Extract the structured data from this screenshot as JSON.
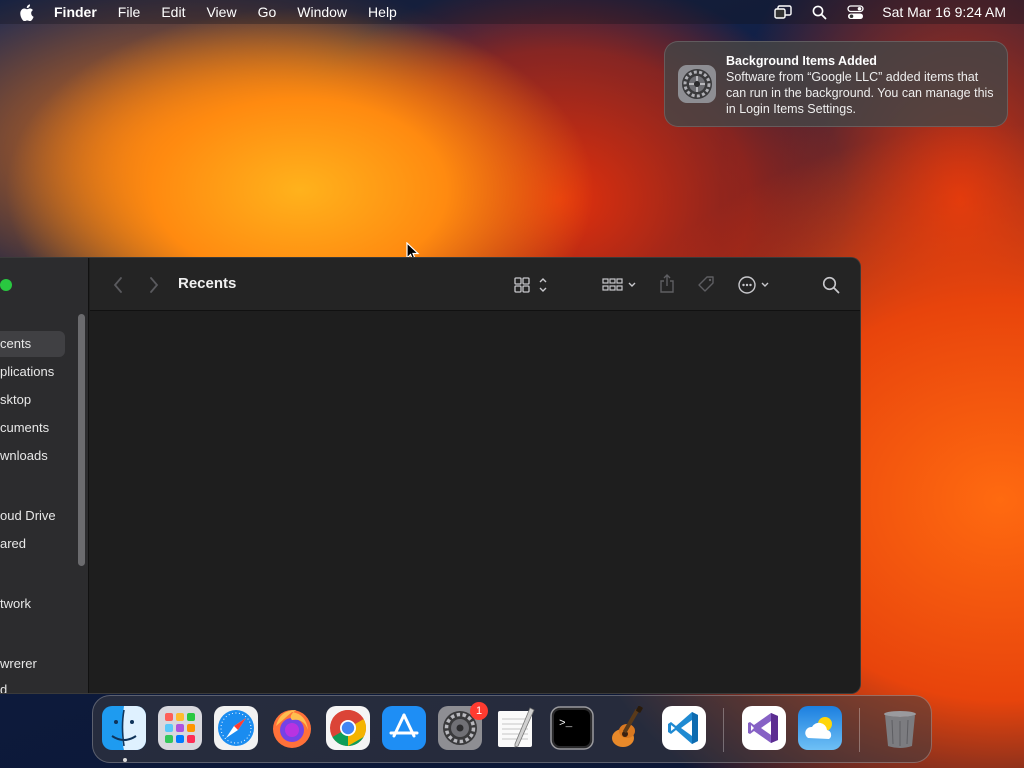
{
  "menubar": {
    "app_name": "Finder",
    "menus": [
      "File",
      "Edit",
      "View",
      "Go",
      "Window",
      "Help"
    ],
    "clock": "Sat Mar 16  9:24 AM"
  },
  "notification": {
    "title": "Background Items Added",
    "body": "Software from “Google LLC” added items that can run in the background. You can manage this in Login Items Settings."
  },
  "finder": {
    "title": "Recents",
    "sidebar": {
      "sections": [
        {
          "label": "s"
        },
        {
          "label": "s"
        }
      ],
      "items": [
        {
          "label": "cents"
        },
        {
          "label": "plications"
        },
        {
          "label": "sktop"
        },
        {
          "label": "cuments"
        },
        {
          "label": "wnloads"
        },
        {
          "label": "oud Drive"
        },
        {
          "label": "ared"
        },
        {
          "label": "twork"
        },
        {
          "label": "wrerer"
        },
        {
          "label": "d"
        }
      ]
    }
  },
  "dock": {
    "apps": [
      {
        "name": "Finder",
        "icon": "finder-icon",
        "running": true
      },
      {
        "name": "Launchpad",
        "icon": "launchpad-icon"
      },
      {
        "name": "Safari",
        "icon": "safari-icon"
      },
      {
        "name": "Firefox",
        "icon": "firefox-icon"
      },
      {
        "name": "Chrome",
        "icon": "chrome-icon"
      },
      {
        "name": "App Store",
        "icon": "app-store-icon"
      },
      {
        "name": "System Settings",
        "icon": "system-settings-icon",
        "badge": "1"
      },
      {
        "name": "TextEdit",
        "icon": "textedit-icon"
      },
      {
        "name": "Terminal",
        "icon": "terminal-icon"
      },
      {
        "name": "GarageBand",
        "icon": "garageband-icon"
      },
      {
        "name": "Visual Studio Code",
        "icon": "vscode-icon"
      },
      {
        "name": "Visual Studio",
        "icon": "visual-studio-icon"
      },
      {
        "name": "Weather",
        "icon": "weather-icon"
      },
      {
        "name": "Trash",
        "icon": "trash-icon"
      }
    ],
    "terminal_prompt": ">_"
  },
  "colors": {
    "accent_green": "#29c840",
    "badge_red": "#ff3b30",
    "window_bg": "#1e1e1e",
    "sidebar_bg": "#2c2c2e"
  }
}
